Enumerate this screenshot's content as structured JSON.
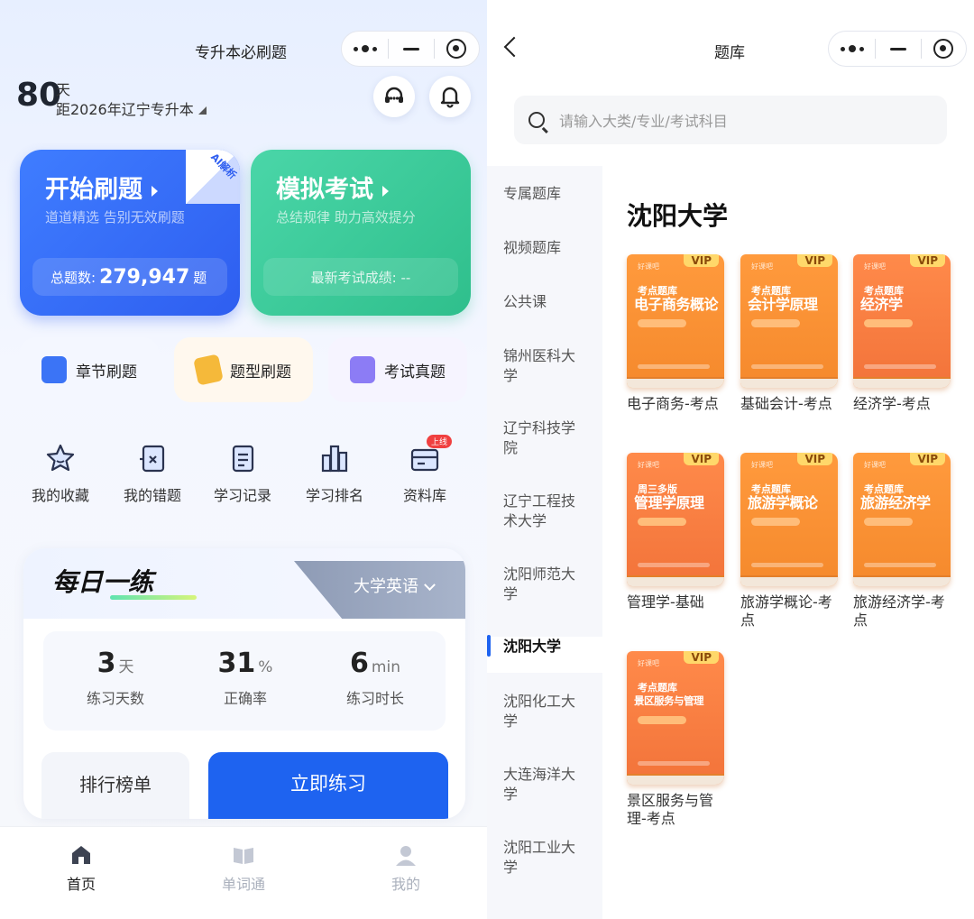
{
  "left": {
    "nav_title": "专升本必刷题",
    "countdown": {
      "days": "80",
      "unit": "天",
      "text": "距2026年辽宁专升本"
    },
    "start_card": {
      "title": "开始刷题",
      "subtitle": "道道精选 告别无效刷题",
      "count_label": "总题数:",
      "count_value": "279,947",
      "count_unit": "题",
      "badge": "AI解析"
    },
    "mock_card": {
      "title": "模拟考试",
      "subtitle": "总结规律 助力高效提分",
      "score_label": "最新考试成绩: --"
    },
    "modes": [
      {
        "label": "章节刷题",
        "icon": "chapter-icon",
        "color": "#3b74f6"
      },
      {
        "label": "题型刷题",
        "icon": "question-type-icon",
        "color": "#f5b93a"
      },
      {
        "label": "考试真题",
        "icon": "past-exam-icon",
        "color": "#8c7cf5"
      }
    ],
    "quick_actions": [
      {
        "label": "我的收藏",
        "icon": "star-icon"
      },
      {
        "label": "我的错题",
        "icon": "wrong-questions-icon"
      },
      {
        "label": "学习记录",
        "icon": "study-record-icon"
      },
      {
        "label": "学习排名",
        "icon": "ranking-icon"
      },
      {
        "label": "资料库",
        "icon": "library-icon",
        "badge": "上线"
      }
    ],
    "daily": {
      "title": "每日一练",
      "subject": "大学英语",
      "stats": [
        {
          "value": "3",
          "unit": "天",
          "label": "练习天数"
        },
        {
          "value": "31",
          "unit": "%",
          "label": "正确率"
        },
        {
          "value": "6",
          "unit": "min",
          "label": "练习时长"
        }
      ],
      "rank_button": "排行榜单",
      "practice_button": "立即练习"
    },
    "tabbar": [
      {
        "label": "首页",
        "icon": "home-icon"
      },
      {
        "label": "单词通",
        "icon": "word-book-icon"
      },
      {
        "label": "我的",
        "icon": "profile-icon"
      }
    ]
  },
  "right": {
    "nav_title": "题库",
    "search_placeholder": "请输入大类/专业/考试科目",
    "sidebar": [
      "专属题库",
      "视频题库",
      "公共课",
      "锦州医科大学",
      "辽宁科技学院",
      "辽宁工程技术大学",
      "沈阳师范大学",
      "沈阳大学",
      "沈阳化工大学",
      "大连海洋大学",
      "沈阳工业大学"
    ],
    "active_university": "沈阳大学",
    "books": [
      {
        "cover_kicker": "考点题库",
        "cover_title": "电子商务概论",
        "name": "电子商务-考点",
        "vip": "VIP",
        "brand": "好课吧",
        "color": "orange"
      },
      {
        "cover_kicker": "考点题库",
        "cover_title": "会计学原理",
        "name": "基础会计-考点",
        "vip": "VIP",
        "brand": "好课吧",
        "color": "orange"
      },
      {
        "cover_kicker": "考点题库",
        "cover_title": "经济学",
        "name": "经济学-考点",
        "vip": "VIP",
        "brand": "好课吧",
        "color": "red"
      },
      {
        "cover_kicker": "周三多版",
        "cover_title": "管理学原理",
        "name": "管理学-基础",
        "vip": "VIP",
        "brand": "好课吧",
        "color": "red"
      },
      {
        "cover_kicker": "考点题库",
        "cover_title": "旅游学概论",
        "name": "旅游学概论-考点",
        "vip": "VIP",
        "brand": "好课吧",
        "color": "orange"
      },
      {
        "cover_kicker": "考点题库",
        "cover_title": "旅游经济学",
        "name": "旅游经济学-考点",
        "vip": "VIP",
        "brand": "好课吧",
        "color": "orange"
      },
      {
        "cover_kicker": "考点题库",
        "cover_title": "景区服务与管理",
        "name": "景区服务与管理-考点",
        "vip": "VIP",
        "brand": "好课吧",
        "color": "red"
      }
    ]
  }
}
